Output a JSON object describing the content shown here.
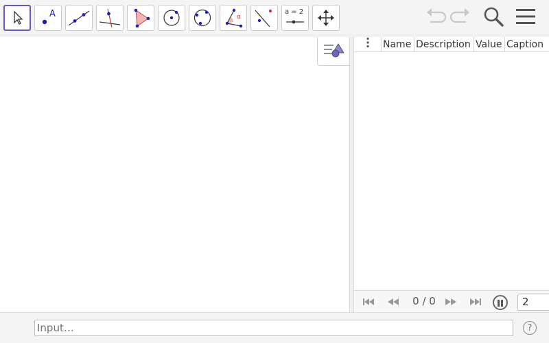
{
  "toolbar": {
    "tools": [
      {
        "icon": "move-tool-icon",
        "selected": true
      },
      {
        "icon": "point-tool-icon",
        "label": "A"
      },
      {
        "icon": "line-tool-icon"
      },
      {
        "icon": "perpendicular-line-tool-icon"
      },
      {
        "icon": "polygon-tool-icon"
      },
      {
        "icon": "circle-center-point-tool-icon"
      },
      {
        "icon": "circle-three-points-tool-icon"
      },
      {
        "icon": "angle-tool-icon",
        "label": "α"
      },
      {
        "icon": "reflect-tool-icon"
      },
      {
        "icon": "slider-tool-icon",
        "label": "a = 2"
      },
      {
        "icon": "move-graphics-view-tool-icon"
      }
    ],
    "undo_icon": "undo-icon",
    "redo_icon": "redo-icon",
    "search_icon": "search-icon",
    "menu_icon": "hamburger-menu-icon"
  },
  "graphics": {
    "style_bar_icon": "style-bar-toggle-icon"
  },
  "protocol": {
    "columns": [
      "Name",
      "Description",
      "Value",
      "Caption"
    ],
    "navigation": {
      "step_text": "0 / 0",
      "speed_value": "2"
    }
  },
  "inputbar": {
    "placeholder": "Input…",
    "help_text": "?"
  },
  "colors": {
    "accent": "#6557d2",
    "point_blue": "#1e1ebe",
    "polygon_fill": "#f5b5b5",
    "toolbar_bg": "#f4f4f4"
  }
}
